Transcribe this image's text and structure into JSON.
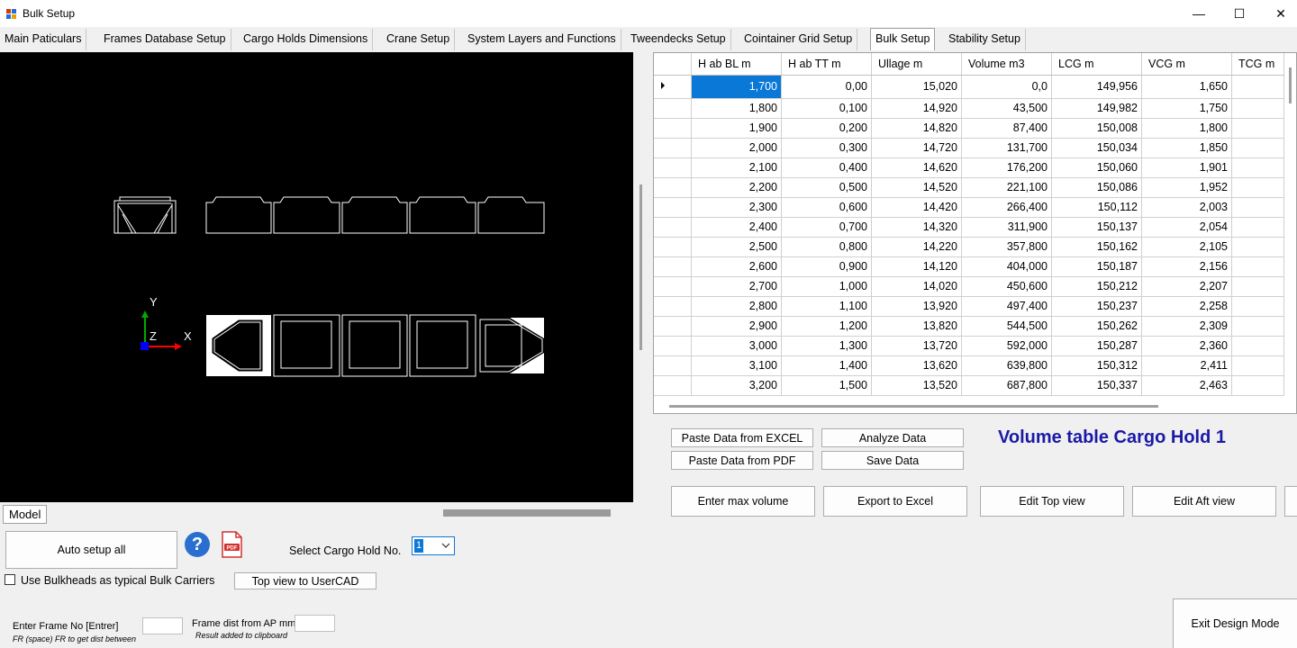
{
  "window": {
    "title": "Bulk Setup",
    "minimize": "—",
    "maximize": "☐",
    "close": "✕"
  },
  "tabs": [
    "Main Paticulars",
    "Frames Database Setup",
    "Cargo Holds Dimensions",
    "Crane Setup",
    "System Layers and Functions",
    "Tweendecks Setup",
    "Cointainer Grid Setup",
    "Bulk Setup",
    "Stability Setup"
  ],
  "active_tab": "Bulk Setup",
  "viewport": {
    "axis_y": "Y",
    "axis_x": "X",
    "axis_z": "Z",
    "model_tab": "Model"
  },
  "grid": {
    "columns": [
      "H ab BL m",
      "H ab TT m",
      "Ullage m",
      "Volume m3",
      "LCG m",
      "VCG m",
      "TCG m"
    ],
    "rows": [
      [
        "1,700",
        "0,00",
        "15,020",
        "0,0",
        "149,956",
        "1,650",
        ""
      ],
      [
        "1,800",
        "0,100",
        "14,920",
        "43,500",
        "149,982",
        "1,750",
        ""
      ],
      [
        "1,900",
        "0,200",
        "14,820",
        "87,400",
        "150,008",
        "1,800",
        ""
      ],
      [
        "2,000",
        "0,300",
        "14,720",
        "131,700",
        "150,034",
        "1,850",
        ""
      ],
      [
        "2,100",
        "0,400",
        "14,620",
        "176,200",
        "150,060",
        "1,901",
        ""
      ],
      [
        "2,200",
        "0,500",
        "14,520",
        "221,100",
        "150,086",
        "1,952",
        ""
      ],
      [
        "2,300",
        "0,600",
        "14,420",
        "266,400",
        "150,112",
        "2,003",
        ""
      ],
      [
        "2,400",
        "0,700",
        "14,320",
        "311,900",
        "150,137",
        "2,054",
        ""
      ],
      [
        "2,500",
        "0,800",
        "14,220",
        "357,800",
        "150,162",
        "2,105",
        ""
      ],
      [
        "2,600",
        "0,900",
        "14,120",
        "404,000",
        "150,187",
        "2,156",
        ""
      ],
      [
        "2,700",
        "1,000",
        "14,020",
        "450,600",
        "150,212",
        "2,207",
        ""
      ],
      [
        "2,800",
        "1,100",
        "13,920",
        "497,400",
        "150,237",
        "2,258",
        ""
      ],
      [
        "2,900",
        "1,200",
        "13,820",
        "544,500",
        "150,262",
        "2,309",
        ""
      ],
      [
        "3,000",
        "1,300",
        "13,720",
        "592,000",
        "150,287",
        "2,360",
        ""
      ],
      [
        "3,100",
        "1,400",
        "13,620",
        "639,800",
        "150,312",
        "2,411",
        ""
      ],
      [
        "3,200",
        "1,500",
        "13,520",
        "687,800",
        "150,337",
        "2,463",
        ""
      ]
    ]
  },
  "buttons": {
    "paste_excel": "Paste Data from EXCEL",
    "analyze": "Analyze Data",
    "paste_pdf": "Paste Data from PDF",
    "save": "Save Data",
    "enter_max": "Enter max volume",
    "export_excel": "Export  to Excel",
    "edit_top": "Edit Top view",
    "edit_aft": "Edit Aft view",
    "auto_setup": "Auto setup all",
    "top_view_usercad": "Top view to UserCAD",
    "exit_design": "Exit Design Mode"
  },
  "volume_title": "Volume table Cargo Hold 1",
  "select_hold": {
    "label": "Select Cargo Hold No.",
    "value": "1"
  },
  "checkbox": {
    "label": "Use Bulkheads as typical Bulk Carriers",
    "checked": false
  },
  "frame_entry": {
    "label": "Enter Frame No [Entrer]",
    "hint": "FR (space) FR to get dist between",
    "value": ""
  },
  "frame_dist": {
    "label": "Frame dist from AP mm",
    "hint": "Result  added to clipboard",
    "value": ""
  },
  "icons": {
    "help": "help-icon",
    "pdf": "pdf-icon"
  },
  "colors": {
    "selection": "#0a78d7",
    "title_blue": "#1a1aa6",
    "axis_y": "#00aa00",
    "axis_x": "#ff0000",
    "axis_z": "#0000ff"
  }
}
